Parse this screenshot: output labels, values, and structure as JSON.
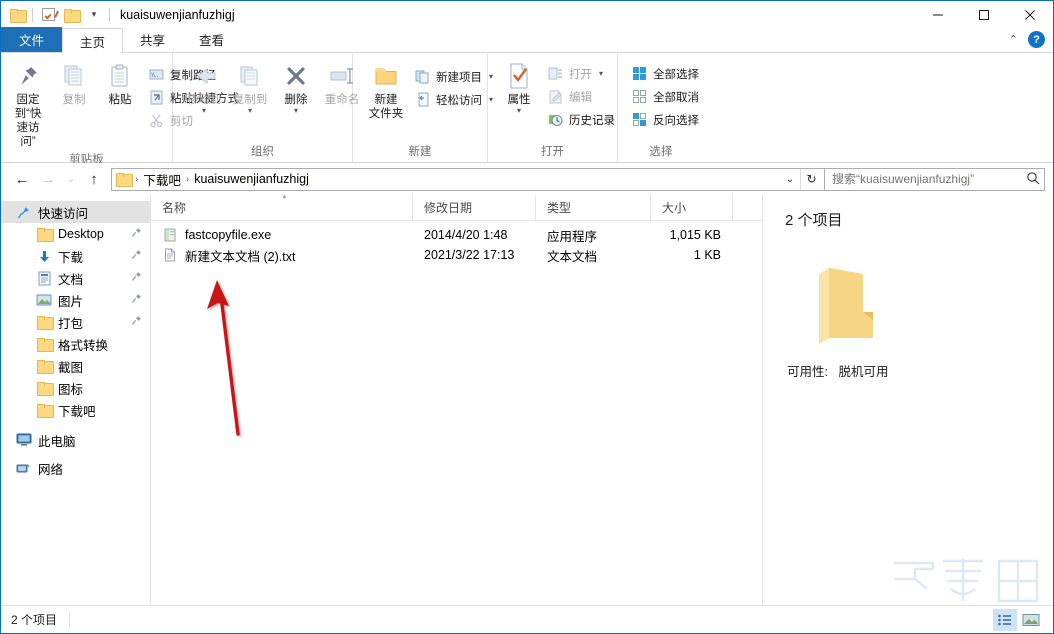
{
  "window": {
    "title": "kuaisuwenjianfuzhigj",
    "controls": {
      "minimize": "—",
      "maximize": "□",
      "close": "✕"
    }
  },
  "quick_access_toolbar": {
    "items": [
      {
        "name": "folder-icon",
        "label": ""
      },
      {
        "name": "properties-check-icon",
        "label": ""
      },
      {
        "name": "new-folder-icon",
        "label": ""
      },
      {
        "name": "customize-caret",
        "label": "▾"
      }
    ]
  },
  "tabs": [
    {
      "id": "file",
      "label": "文件"
    },
    {
      "id": "home",
      "label": "主页"
    },
    {
      "id": "share",
      "label": "共享"
    },
    {
      "id": "view",
      "label": "查看"
    }
  ],
  "tabstrip_right": {
    "collapse": "⌃",
    "help": "?"
  },
  "ribbon": {
    "groups": [
      {
        "name": "clipboard",
        "label": "剪贴板",
        "big_buttons": [
          {
            "name": "pin-to-quick-access",
            "label_line1": "固定到“快",
            "label_line2": "速访问”",
            "icon": "pin-icon",
            "disabled": false
          },
          {
            "name": "copy",
            "label_line1": "复制",
            "label_line2": "",
            "icon": "copy-icon",
            "disabled": true
          },
          {
            "name": "paste",
            "label_line1": "粘贴",
            "label_line2": "",
            "icon": "paste-icon",
            "disabled": false
          }
        ],
        "small_buttons": [
          {
            "name": "copy-path",
            "label": "复制路径",
            "icon": "copy-path-icon",
            "disabled": false
          },
          {
            "name": "paste-shortcut",
            "label": "粘贴快捷方式",
            "icon": "paste-shortcut-icon",
            "disabled": false
          },
          {
            "name": "cut",
            "label": "剪切",
            "icon": "scissors-icon",
            "disabled": true
          }
        ]
      },
      {
        "name": "organize",
        "label": "组织",
        "big_buttons": [
          {
            "name": "move-to",
            "label_line1": "移动到",
            "label_line2": "",
            "icon": "move-to-icon",
            "disabled": true,
            "caret": true
          },
          {
            "name": "copy-to",
            "label_line1": "复制到",
            "label_line2": "",
            "icon": "copy-to-icon",
            "disabled": true,
            "caret": true
          },
          {
            "name": "delete",
            "label_line1": "删除",
            "label_line2": "",
            "icon": "delete-icon",
            "disabled": false,
            "caret": true
          },
          {
            "name": "rename",
            "label_line1": "重命名",
            "label_line2": "",
            "icon": "rename-icon",
            "disabled": true
          }
        ],
        "small_buttons": []
      },
      {
        "name": "new",
        "label": "新建",
        "big_buttons": [
          {
            "name": "new-folder",
            "label_line1": "新建",
            "label_line2": "文件夹",
            "icon": "new-folder-icon",
            "disabled": false
          }
        ],
        "small_buttons": [
          {
            "name": "new-item",
            "label": "新建项目",
            "icon": "new-item-icon",
            "disabled": false,
            "caret": true
          },
          {
            "name": "easy-access",
            "label": "轻松访问",
            "icon": "easy-access-icon",
            "disabled": false,
            "caret": true
          }
        ]
      },
      {
        "name": "open",
        "label": "打开",
        "big_buttons": [
          {
            "name": "properties",
            "label_line1": "属性",
            "label_line2": "",
            "icon": "properties-icon",
            "disabled": false,
            "caret": true
          }
        ],
        "small_buttons": [
          {
            "name": "open",
            "label": "打开",
            "icon": "open-icon",
            "disabled": true,
            "caret": true
          },
          {
            "name": "edit",
            "label": "编辑",
            "icon": "edit-icon",
            "disabled": true
          },
          {
            "name": "history",
            "label": "历史记录",
            "icon": "history-icon",
            "disabled": false
          }
        ]
      },
      {
        "name": "select",
        "label": "选择",
        "big_buttons": [],
        "small_buttons": [
          {
            "name": "select-all",
            "label": "全部选择",
            "icon": "select-all-icon",
            "disabled": false
          },
          {
            "name": "select-none",
            "label": "全部取消",
            "icon": "select-none-icon",
            "disabled": false
          },
          {
            "name": "invert-selection",
            "label": "反向选择",
            "icon": "invert-selection-icon",
            "disabled": false
          }
        ]
      }
    ]
  },
  "addressbar": {
    "back": "←",
    "forward": "→",
    "recent": "⌄",
    "up": "↑",
    "breadcrumbs": [
      "下载吧",
      "kuaisuwenjianfuzhigj"
    ],
    "separator": "›",
    "dropdown": "⌄",
    "refresh": "↻",
    "search_placeholder": "搜索“kuaisuwenjianfuzhigj”",
    "search_value": "",
    "search_icon": "search-icon"
  },
  "navpane": {
    "items": [
      {
        "name": "quick-access",
        "label": "快速访问",
        "icon": "star-pin-icon",
        "level": 0,
        "selected": true,
        "pinned": false
      },
      {
        "name": "desktop",
        "label": "Desktop",
        "icon": "folder-icon",
        "level": 1,
        "selected": false,
        "pinned": true
      },
      {
        "name": "downloads",
        "label": "下载",
        "icon": "download-arrow-icon",
        "level": 1,
        "selected": false,
        "pinned": true
      },
      {
        "name": "documents",
        "label": "文档",
        "icon": "documents-icon",
        "level": 1,
        "selected": false,
        "pinned": true
      },
      {
        "name": "pictures",
        "label": "图片",
        "icon": "pictures-icon",
        "level": 1,
        "selected": false,
        "pinned": true
      },
      {
        "name": "dabao",
        "label": "打包",
        "icon": "folder-icon",
        "level": 1,
        "selected": false,
        "pinned": true
      },
      {
        "name": "geshizhuanhuan",
        "label": "格式转换",
        "icon": "folder-icon",
        "level": 1,
        "selected": false,
        "pinned": false
      },
      {
        "name": "jietu",
        "label": "截图",
        "icon": "folder-icon",
        "level": 1,
        "selected": false,
        "pinned": false
      },
      {
        "name": "tubiao",
        "label": "图标",
        "icon": "folder-icon",
        "level": 1,
        "selected": false,
        "pinned": false
      },
      {
        "name": "xiazaiba",
        "label": "下载吧",
        "icon": "folder-icon",
        "level": 1,
        "selected": false,
        "pinned": false
      },
      {
        "name": "this-pc",
        "label": "此电脑",
        "icon": "monitor-icon",
        "level": 0,
        "selected": false,
        "pinned": false
      },
      {
        "name": "network",
        "label": "网络",
        "icon": "network-icon",
        "level": 0,
        "selected": false,
        "pinned": false
      }
    ]
  },
  "filelist": {
    "columns": [
      {
        "name": "name",
        "label": "名称",
        "sorted": true
      },
      {
        "name": "date-modified",
        "label": "修改日期",
        "sorted": false
      },
      {
        "name": "type",
        "label": "类型",
        "sorted": false
      },
      {
        "name": "size",
        "label": "大小",
        "sorted": false
      }
    ],
    "rows": [
      {
        "icon": "exe-icon",
        "name": "fastcopyfile.exe",
        "date": "2014/4/20 1:48",
        "type": "应用程序",
        "size": "1,015 KB"
      },
      {
        "icon": "txt-icon",
        "name": "新建文本文档 (2).txt",
        "date": "2021/3/22 17:13",
        "type": "文本文档",
        "size": "1 KB"
      }
    ]
  },
  "detailpane": {
    "count": "2 个项目",
    "icon": "folder-large-icon",
    "availability_label": "可用性:",
    "availability_value": "脱机可用"
  },
  "statusbar": {
    "item_count": "2 个项目",
    "views": [
      {
        "name": "details-view-button",
        "active": true
      },
      {
        "name": "large-icons-view-button",
        "active": false
      }
    ]
  },
  "watermark": {
    "text": "下载吧",
    "url": "www.xiazaiba.com"
  },
  "annotation": {
    "name": "red-arrow",
    "color": "#c81919"
  },
  "colors": {
    "accent": "#1e6fb8",
    "folder": "#fcd97f",
    "selection": "#cce3f5",
    "border": "#0a6cbc"
  }
}
